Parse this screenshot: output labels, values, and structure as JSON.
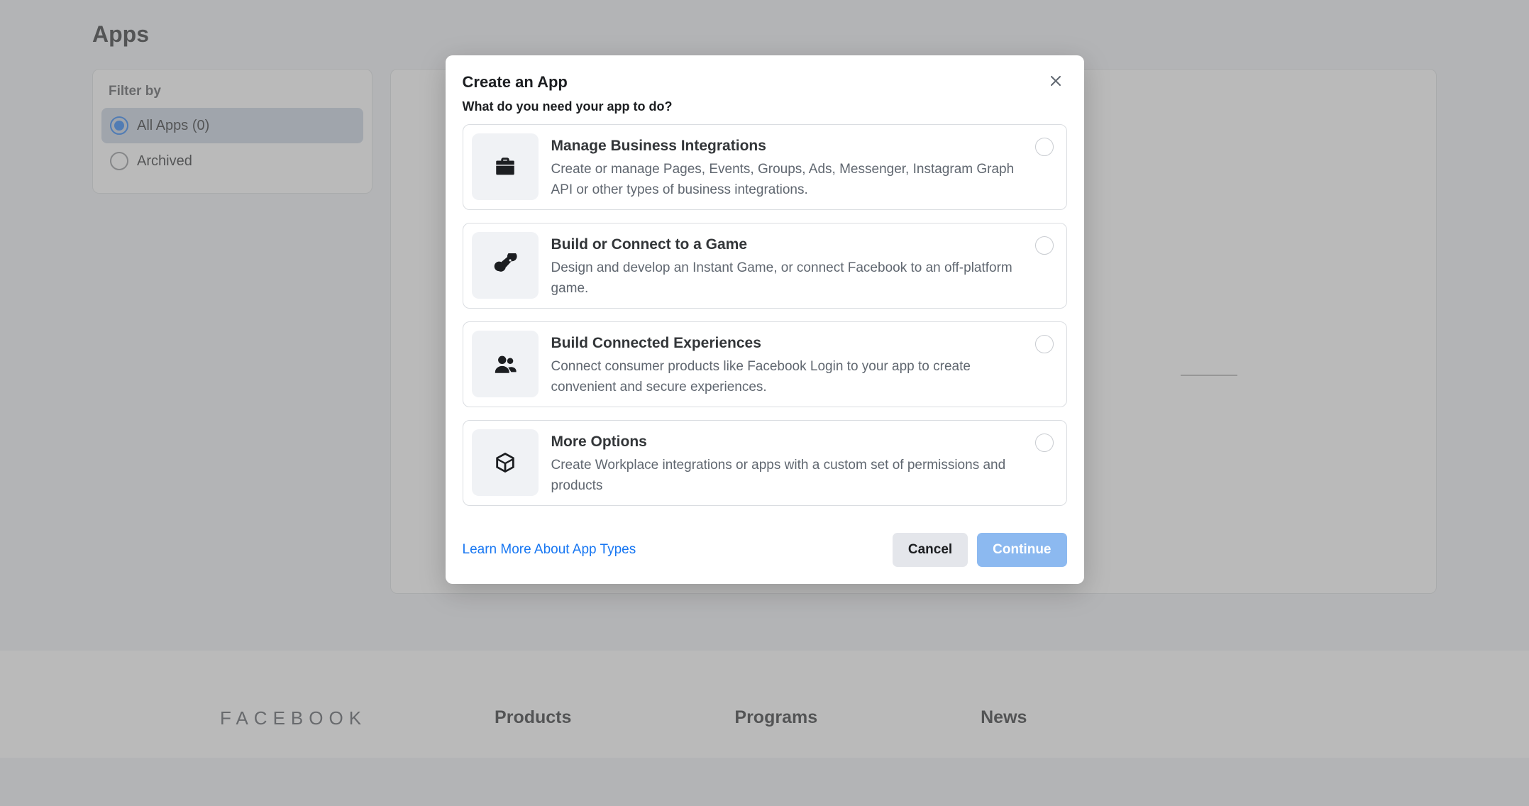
{
  "page": {
    "title": "Apps"
  },
  "sidebar": {
    "filter_label": "Filter by",
    "options": [
      {
        "label": "All Apps (0)",
        "selected": true
      },
      {
        "label": "Archived",
        "selected": false
      }
    ]
  },
  "modal": {
    "title": "Create an App",
    "subtitle": "What do you need your app to do?",
    "options": [
      {
        "icon": "briefcase-icon",
        "title": "Manage Business Integrations",
        "desc": "Create or manage Pages, Events, Groups, Ads, Messenger, Instagram Graph API or other types of business integrations."
      },
      {
        "icon": "game-icon",
        "title": "Build or Connect to a Game",
        "desc": "Design and develop an Instant Game, or connect Facebook to an off-platform game."
      },
      {
        "icon": "people-icon",
        "title": "Build Connected Experiences",
        "desc": "Connect consumer products like Facebook Login to your app to create convenient and secure experiences."
      },
      {
        "icon": "cube-icon",
        "title": "More Options",
        "desc": "Create Workplace integrations or apps with a custom set of permissions and products"
      }
    ],
    "learn_more": "Learn More About App Types",
    "cancel": "Cancel",
    "continue": "Continue"
  },
  "footer": {
    "logo": "FACEBOOK",
    "cols": [
      {
        "title": "Products"
      },
      {
        "title": "Programs"
      },
      {
        "title": "News"
      }
    ]
  }
}
